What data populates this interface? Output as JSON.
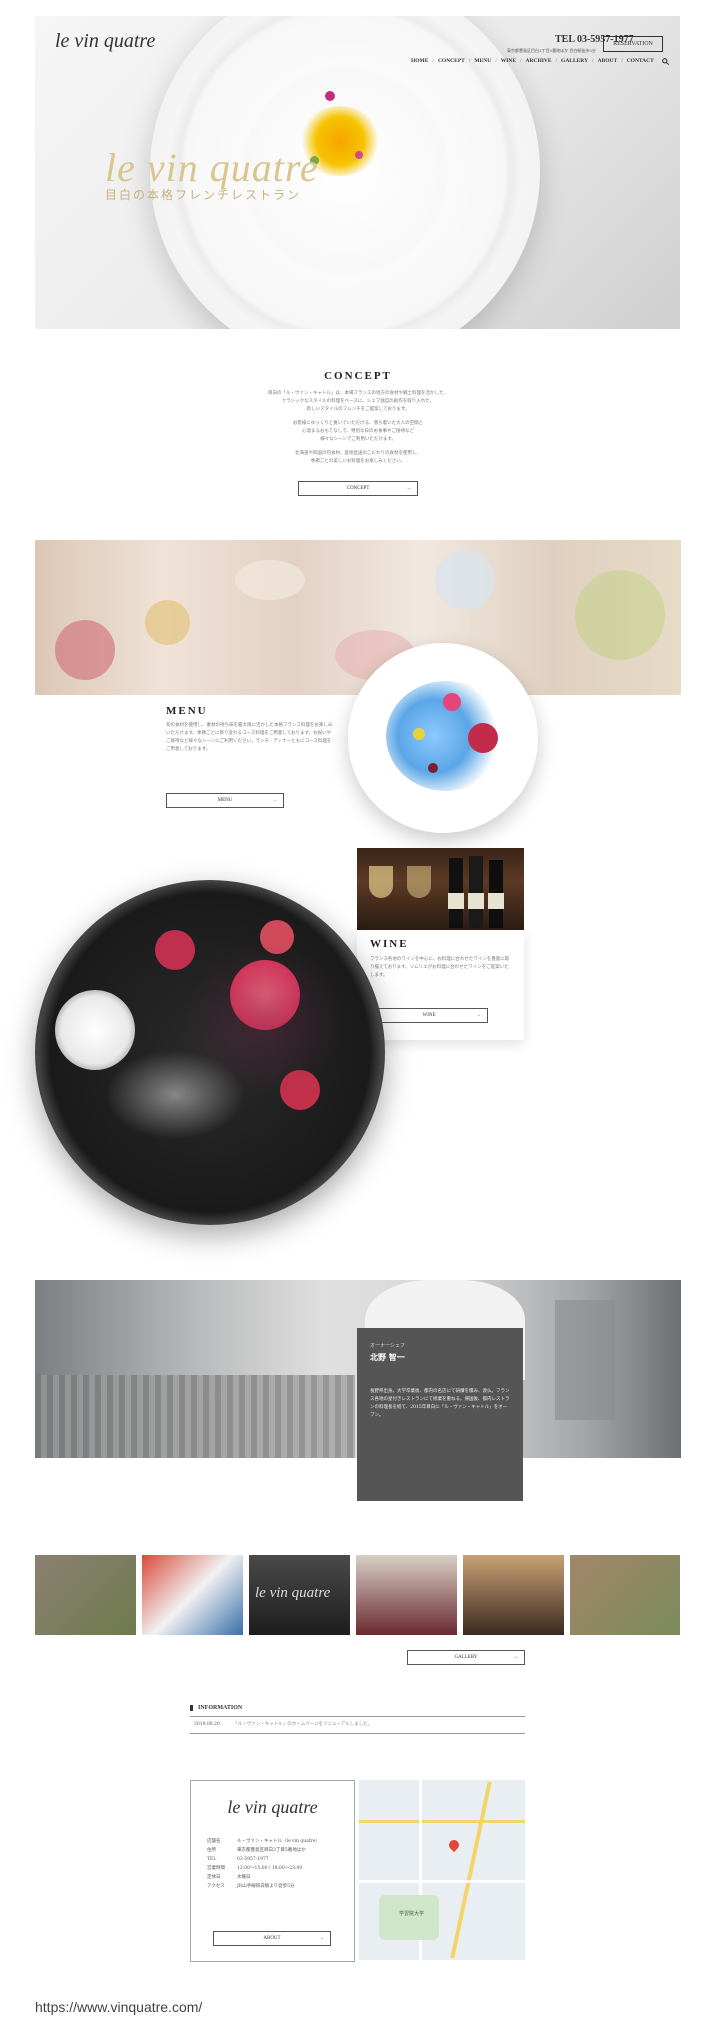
{
  "header": {
    "logo": "le vin quatre",
    "tel": "TEL 03-5957-1977",
    "address": "東京都豊島区目白3丁目5番地ほか 目白駅徒歩5分",
    "reservation": "RESERVATION",
    "nav": [
      "HOME",
      "CONCEPT",
      "MENU",
      "WINE",
      "ARCHIVE",
      "GALLERY",
      "ABOUT",
      "CONTACT"
    ]
  },
  "hero": {
    "title": "le vin quatre",
    "subtitle": "目白の本格フレンチレストラン"
  },
  "concept": {
    "title": "CONCEPT",
    "lines": [
      "目白の「ル・ヴァン・キャトル」は、本場フランスの地方の食材や郷土料理を活かした、",
      "クラシックなスタイルの料理をベースに、シェフ独自の創作を取り入れた、",
      "新しいスタイルのフレンチをご提案しております。",
      "",
      "お客様にゆっくりと寛いでいただける、落ち着いた大人の空間と",
      "心温まるおもてなしで、特別な日のお食事やご接待など",
      "様々なシーンでご利用いただけます。",
      "",
      "北海道や四国の旬食材、産地直送のこだわりの食材を使用し、",
      "季節ごとの美しいお料理をお楽しみください。"
    ],
    "button": "CONCEPT"
  },
  "menu": {
    "title": "MENU",
    "text": "旬の食材を使用し、素材の持ち味を最大限に活かした本格フランス料理をお楽しみいただけます。季節ごとに移り変わるコース料理をご用意しております。お祝いやご接待など様々なシーンにご利用ください。ランチ、ディナーともにコース料理をご用意しております。",
    "button": "MENU"
  },
  "wine": {
    "title": "WINE",
    "text": "フランス各地のワインを中心に、お料理に合わせたワインを豊富に取り揃えております。ソムリエがお料理に合わせたワインをご提案いたします。",
    "button": "WINE"
  },
  "chef": {
    "role": "オーナーシェフ",
    "name": "北野 智一",
    "text": "長野県出身。大学卒業後、都内の名店にて研鑽を積み、渡仏。フランス各地の星付きレストランにて修業を重ねる。帰国後、都内レストランの料理長を経て、2015年目白に「ル・ヴァン・キャトル」をオープン。"
  },
  "gallery": {
    "button": "GALLERY"
  },
  "information": {
    "title": "INFORMATION",
    "items": [
      {
        "date": "2019.08.20",
        "text": "「ル・ヴァン・キャトル」のホームページをリニューアルしました。"
      }
    ]
  },
  "access": {
    "logo": "le vin quatre",
    "rows": [
      {
        "k": "店舗名",
        "v": "ル・ヴァン・キャトル（le vin quatre）"
      },
      {
        "k": "住所",
        "v": "東京都豊島区目白3丁目5番地ほか"
      },
      {
        "k": "TEL",
        "v": "03-5957-1977"
      },
      {
        "k": "営業時間",
        "v": "12:00〜15:00 / 18:00〜23:00"
      },
      {
        "k": "定休日",
        "v": "水曜日"
      },
      {
        "k": "アクセス",
        "v": "JR山手線目白駅より徒歩5分"
      }
    ],
    "button": "ABOUT"
  },
  "map": {
    "label": "学習院大学"
  },
  "footer": {
    "url": "https://www.vinquatre.com/"
  }
}
